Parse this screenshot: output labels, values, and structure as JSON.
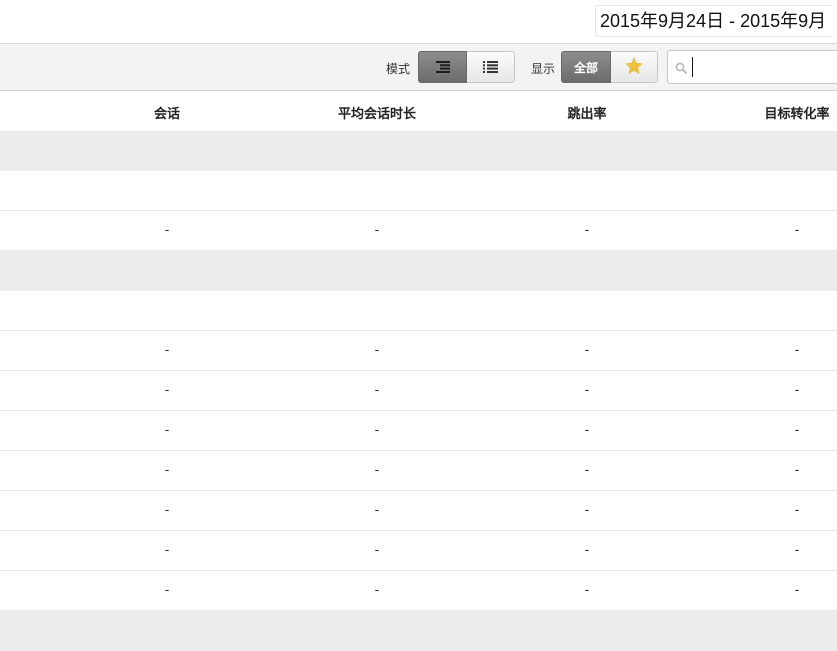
{
  "date_range": "2015年9月24日 - 2015年9月",
  "toolbar": {
    "mode_label": "模式",
    "show_label": "显示",
    "show_all_label": "全部",
    "search_value": ""
  },
  "table": {
    "headers": [
      "会话",
      "平均会话时长",
      "跳出率",
      "目标转化率"
    ],
    "rows": [
      {
        "type": "group",
        "cells": [
          "",
          "",
          "",
          ""
        ]
      },
      {
        "type": "blank",
        "cells": [
          "",
          "",
          "",
          ""
        ]
      },
      {
        "type": "data",
        "cells": [
          "-",
          "-",
          "-",
          "-"
        ]
      },
      {
        "type": "group",
        "cells": [
          "",
          "",
          "",
          ""
        ]
      },
      {
        "type": "blank",
        "cells": [
          "",
          "",
          "",
          ""
        ]
      },
      {
        "type": "data",
        "cells": [
          "-",
          "-",
          "-",
          "-"
        ]
      },
      {
        "type": "data",
        "cells": [
          "-",
          "-",
          "-",
          "-"
        ]
      },
      {
        "type": "data",
        "cells": [
          "-",
          "-",
          "-",
          "-"
        ]
      },
      {
        "type": "data",
        "cells": [
          "-",
          "-",
          "-",
          "-"
        ]
      },
      {
        "type": "data",
        "cells": [
          "-",
          "-",
          "-",
          "-"
        ]
      },
      {
        "type": "data",
        "cells": [
          "-",
          "-",
          "-",
          "-"
        ]
      },
      {
        "type": "data",
        "cells": [
          "-",
          "-",
          "-",
          "-"
        ]
      },
      {
        "type": "group",
        "cells": [
          "",
          "",
          "",
          ""
        ]
      }
    ]
  },
  "colors": {
    "active_button": "#7a7a7a",
    "star": "#f0c13a",
    "group_row": "#ececec"
  },
  "icons": [
    "tree-mode-icon",
    "list-mode-icon",
    "star-icon",
    "search-icon"
  ]
}
